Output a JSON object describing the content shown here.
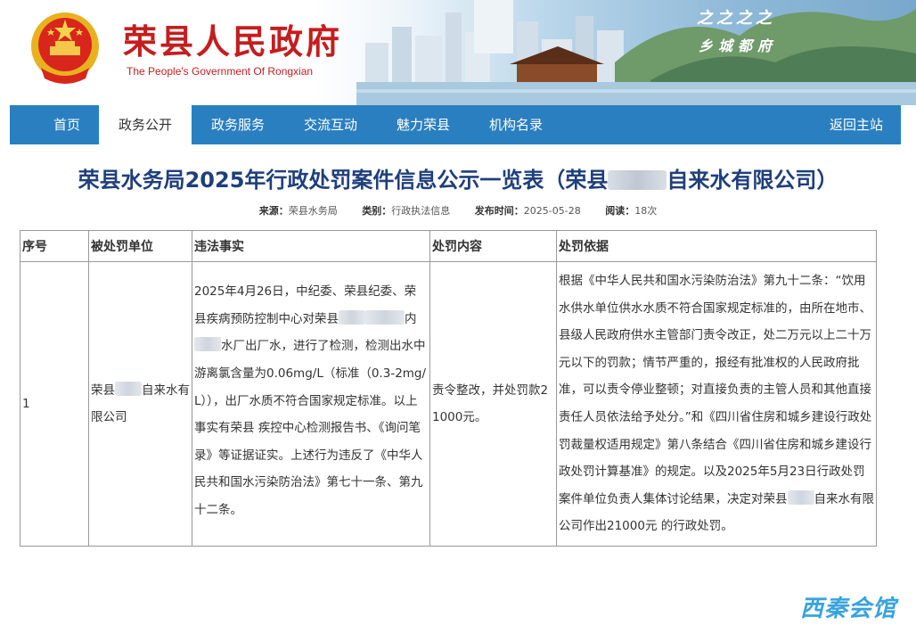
{
  "header": {
    "site_title": "荣县人民政府",
    "site_subtitle": "The People's Government Of Rongxian",
    "slogan_line1": "之之之之",
    "slogan_line2": "乡城都府"
  },
  "nav": {
    "items": [
      {
        "label": "首页",
        "active": false
      },
      {
        "label": "政务公开",
        "active": true
      },
      {
        "label": "政务服务",
        "active": false
      },
      {
        "label": "交流互动",
        "active": false
      },
      {
        "label": "魅力荣县",
        "active": false
      },
      {
        "label": "机构名录",
        "active": false
      }
    ],
    "return_label": "返回主站"
  },
  "article": {
    "title_before": "荣县水务局2025年行政处罚案件信息公示一览表（荣县",
    "title_after": "自来水有限公司）",
    "meta": {
      "source_label": "来源：",
      "source_value": "荣县水务局",
      "category_label": "类别：",
      "category_value": "行政执法信息",
      "date_label": "发布时间：",
      "date_value": "2025-05-28",
      "reads_label": "阅读：",
      "reads_value": "18次"
    }
  },
  "table": {
    "headers": [
      "序号",
      "被处罚单位",
      "违法事实",
      "处罚内容",
      "处罚依据"
    ],
    "row": {
      "index": "1",
      "unit_before": "荣县",
      "unit_after": "自来水有限公司",
      "fact_part1": "2025年4月26日，中纪委、荣县纪委、荣县疾病预防控制中心对荣县",
      "fact_part2": "内",
      "fact_part3": "水厂出厂水，进行了检测，检测出水中游离氯含量为0.06mg/L（标准（0.3-2mg/L）），出厂水质不符合国家规定标准。以上事实有荣县 疾控中心检测报告书、《询问笔录》等证据证实。上述行为违反了《中华人民共和国水污染防治法》第七十一条、第九十二条。",
      "penalty": "责令整改，并处罚款21000元。",
      "basis_part1": "根据《中华人民共和国水污染防治法》第九十二条：“饮用水供水单位供水水质不符合国家规定标准的，由所在地市、县级人民政府供水主管部门责令改正，处二万元以上二十万元以下的罚款；情节严重的，报经有批准权的人民政府批准，可以责令停业整顿；对直接负责的主管人员和其他直接责任人员依法给予处分。”和《四川省住房和城乡建设行政处罚裁量权适用规定》第八条结合《四川省住房和城乡建设行政处罚计算基准》的规定。以及2025年5月23日行政处罚案件单位负责人集体讨论结果，决定对荣县",
      "basis_part2": "自来水有限公司作出21000元 的行政处罚。"
    }
  },
  "watermark": "西秦会馆",
  "colors": {
    "nav_bg": "#2a7fc0",
    "title_red": "#c41e1e",
    "article_title": "#1f3f7c",
    "watermark": "#3aa3dc"
  }
}
